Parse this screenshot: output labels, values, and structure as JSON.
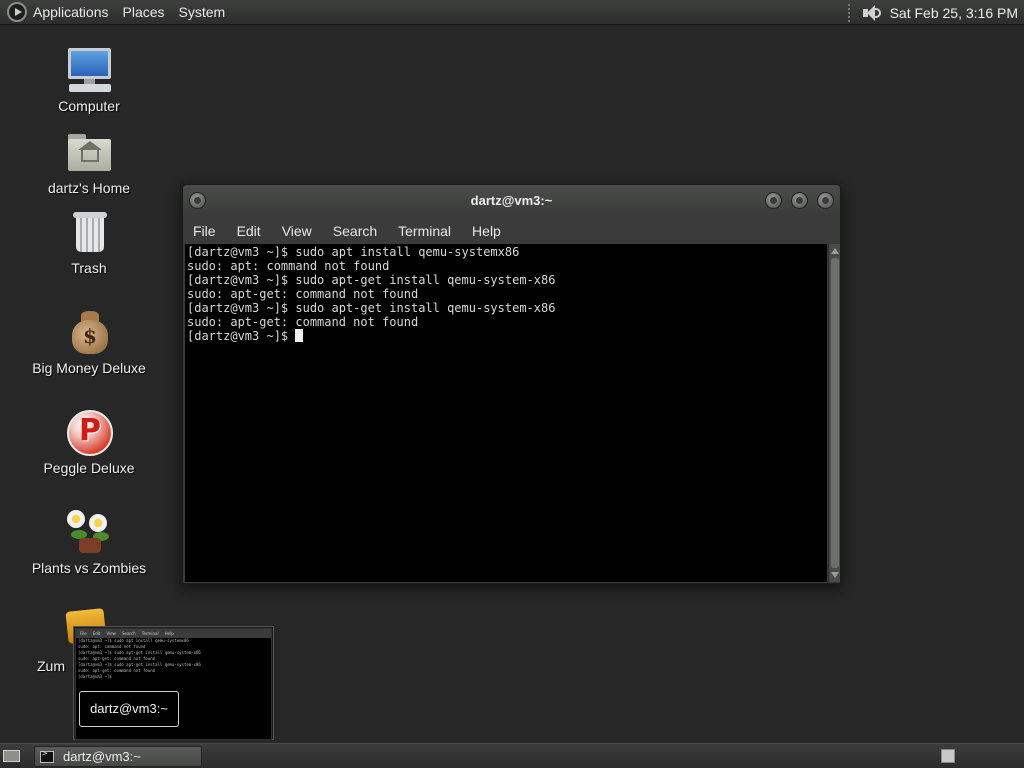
{
  "top_panel": {
    "menus": [
      "Applications",
      "Places",
      "System"
    ],
    "clock": "Sat Feb 25,  3:16 PM",
    "icons": [
      "apps-logo-icon",
      "speaker-icon"
    ]
  },
  "desktop_icons": [
    {
      "label": "Computer",
      "icon": "computer-icon"
    },
    {
      "label": "dartz's Home",
      "icon": "home-folder-icon"
    },
    {
      "label": "Trash",
      "icon": "trash-icon"
    },
    {
      "label": "Big Money Deluxe",
      "icon": "money-bag-icon"
    },
    {
      "label": "Peggle Deluxe",
      "icon": "peggle-icon"
    },
    {
      "label": "Plants vs Zombies",
      "icon": "plants-icon"
    },
    {
      "label": "Zum",
      "icon": "zuma-icon"
    }
  ],
  "terminal": {
    "title": "dartz@vm3:~",
    "menus": [
      "File",
      "Edit",
      "View",
      "Search",
      "Terminal",
      "Help"
    ],
    "lines": [
      "[dartz@vm3 ~]$ sudo apt install qemu-systemx86",
      "sudo: apt: command not found",
      "[dartz@vm3 ~]$ sudo apt-get install qemu-system-x86",
      "sudo: apt-get: command not found",
      "[dartz@vm3 ~]$ sudo apt-get install qemu-system-x86",
      "sudo: apt-get: command not found"
    ],
    "prompt": "[dartz@vm3 ~]$ "
  },
  "preview": {
    "label": "dartz@vm3:~",
    "menus": [
      "File",
      "Edit",
      "View",
      "Search",
      "Terminal",
      "Help"
    ],
    "lines": [
      "[dartz@vm3 ~]$ sudo apt install qemu-systemx86",
      "sudo: apt: command not found",
      "[dartz@vm3 ~]$ sudo apt-get install qemu-system-x86",
      "sudo: apt-get: command not found",
      "[dartz@vm3 ~]$ sudo apt-get install qemu-system-x86",
      "sudo: apt-get: command not found",
      "[dartz@vm3 ~]$ "
    ]
  },
  "taskbar": {
    "task_label": "dartz@vm3:~",
    "icons": [
      "show-desktop-icon",
      "terminal-icon",
      "workspace-switcher-icon"
    ]
  },
  "colors": {
    "desktop_bg": "#262726",
    "terminal_bg": "#000000",
    "terminal_text": "#d8d8d8"
  }
}
